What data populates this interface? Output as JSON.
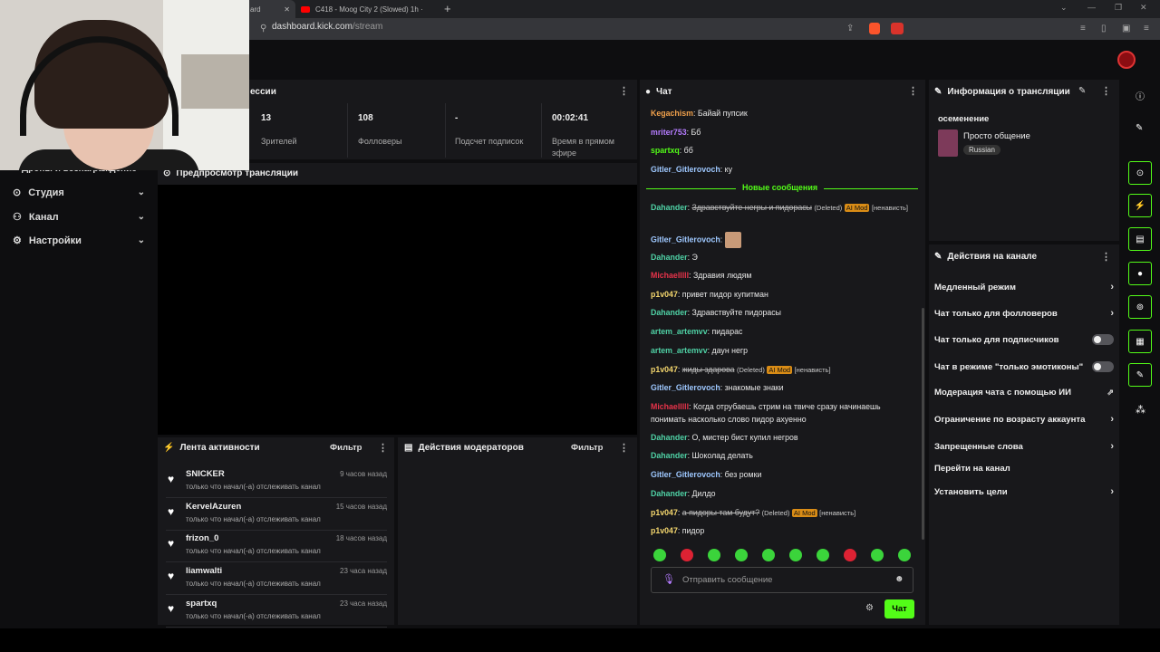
{
  "browser": {
    "tab1_label": "ard",
    "tab2_label": "C418 - Moog City 2 (Slowed) 1h ·",
    "new_tab": "+",
    "url_host": "dashboard.kick.com",
    "url_path": "/stream"
  },
  "sidebar": {
    "partial_label": "Дропы и вознаграждение",
    "items": [
      {
        "label": "Студия",
        "icon": "studio-icon"
      },
      {
        "label": "Канал",
        "icon": "channel-icon"
      },
      {
        "label": "Настройки",
        "icon": "settings-icon"
      }
    ]
  },
  "session": {
    "title": "ессии",
    "stats": [
      {
        "value": "13",
        "label": "Зрителей"
      },
      {
        "value": "108",
        "label": "Фолловеры"
      },
      {
        "value": "-",
        "label": "Подсчет подписок"
      },
      {
        "value": "00:02:41",
        "label": "Время в прямом эфире"
      }
    ]
  },
  "preview": {
    "title": "Предпросмотр трансляции"
  },
  "activity": {
    "title": "Лента активности",
    "filter": "Фильтр",
    "items": [
      {
        "name": "SNICKER",
        "time": "9 часов назад",
        "desc": "только что начал(-а) отслеживать канал"
      },
      {
        "name": "KervelAzuren",
        "time": "15 часов назад",
        "desc": "только что начал(-а) отслеживать канал"
      },
      {
        "name": "frizon_0",
        "time": "18 часов назад",
        "desc": "только что начал(-а) отслеживать канал"
      },
      {
        "name": "liamwalti",
        "time": "23 часа назад",
        "desc": "только что начал(-а) отслеживать канал"
      },
      {
        "name": "spartxq",
        "time": "23 часа назад",
        "desc": "только что начал(-а) отслеживать канал"
      }
    ]
  },
  "moderators": {
    "title": "Действия модераторов",
    "filter": "Фильтр"
  },
  "chat": {
    "title": "Чат",
    "new_messages": "Новые сообщения",
    "deleted_tag": "(Deleted)",
    "ai_tag": "AI Mod",
    "hate_tag": "[ненависть]",
    "messages": [
      {
        "user": "Kegachism",
        "color": "#f0a04b",
        "text": "Байай пупсик"
      },
      {
        "user": "mriter753",
        "color": "#b57cff",
        "text": "Бб"
      },
      {
        "user": "spartxq",
        "color": "#53fc18",
        "text": "бб"
      },
      {
        "user": "Gitler_Gitlerovoch",
        "color": "#9ec8ff",
        "text": "ку"
      },
      {
        "user": "Dahander",
        "color": "#4fd1a5",
        "text": "Здравствуйте негры и пидорасы"
      },
      {
        "user": "Gitler_Gitlerovoch",
        "color": "#9ec8ff",
        "text": ""
      },
      {
        "user": "Dahander",
        "color": "#4fd1a5",
        "text": "Э"
      },
      {
        "user": "Michaelllll",
        "color": "#e8334a",
        "text": "Здравия людям"
      },
      {
        "user": "p1v047",
        "color": "#f5d76e",
        "text": "привет пидор купитман"
      },
      {
        "user": "Dahander",
        "color": "#4fd1a5",
        "text": "Здравствуйте пидорасы"
      },
      {
        "user": "artem_artemvv",
        "color": "#4fd1a5",
        "text": "пидарас"
      },
      {
        "user": "artem_artemvv",
        "color": "#4fd1a5",
        "text": "даун негр"
      },
      {
        "user": "p1v047",
        "color": "#f5d76e",
        "text": "жиды здарова"
      },
      {
        "user": "Gitler_Gitlerovoch",
        "color": "#9ec8ff",
        "text": "знакомые знаки"
      },
      {
        "user": "Michaelllll",
        "color": "#e8334a",
        "text": "Когда отрубаешь стрим на твиче сразу начинаешь понимать насколько слово пидор ахуенно"
      },
      {
        "user": "Dahander",
        "color": "#4fd1a5",
        "text": "О, мистер бист купил негров"
      },
      {
        "user": "Dahander",
        "color": "#4fd1a5",
        "text": "Шоколад делать"
      },
      {
        "user": "Gitler_Gitlerovoch",
        "color": "#9ec8ff",
        "text": "без ромки"
      },
      {
        "user": "Dahander",
        "color": "#4fd1a5",
        "text": "Дилдо"
      },
      {
        "user": "p1v047",
        "color": "#f5d76e",
        "text": "а пидоры там будут?"
      },
      {
        "user": "p1v047",
        "color": "#f5d76e",
        "text": "пидор"
      }
    ],
    "input_placeholder": "Отправить сообщение",
    "send_label": "Чат"
  },
  "stream_info": {
    "title": "Информация о трансляции",
    "stream_title": "осеменение",
    "category": "Просто общение",
    "language": "Russian"
  },
  "channel_actions": {
    "title": "Действия на канале",
    "items": [
      {
        "label": "Медленный режим",
        "control": "chevron"
      },
      {
        "label": "Чат только для фолловеров",
        "control": "chevron"
      },
      {
        "label": "Чат только для подписчиков",
        "control": "toggle"
      },
      {
        "label": "Чат в режиме \"только эмотиконы\"",
        "control": "toggle"
      },
      {
        "label": "Модерация чата с помощью ИИ",
        "control": "external"
      },
      {
        "label": "Ограничение по возрасту аккаунта",
        "control": "chevron"
      },
      {
        "label": "Запрещенные слова",
        "control": "chevron"
      },
      {
        "label": "Перейти на канал",
        "control": "none"
      },
      {
        "label": "Установить цели",
        "control": "chevron"
      }
    ]
  },
  "colors": {
    "accent": "#53fc18",
    "panel": "#18181b",
    "background": "#0e0e10"
  }
}
